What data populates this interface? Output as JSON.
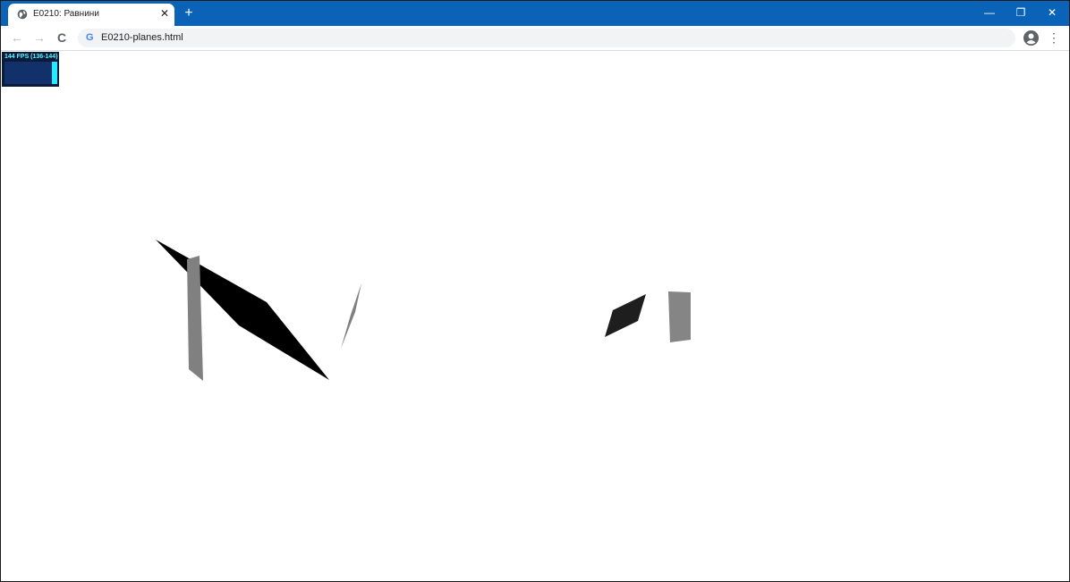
{
  "browser": {
    "tab_title": "E0210: Равнини",
    "tab_close": "✕",
    "new_tab": "+",
    "url": "E0210-planes.html",
    "back": "←",
    "forward": "→",
    "reload": "C",
    "menu": "⋮",
    "minimize": "—",
    "restore": "❐",
    "close": "✕",
    "omnibox_icon": "G",
    "accent_color": "#0b63b7"
  },
  "stats": {
    "label": "144 FPS (136-144)",
    "fps_fraction": 1.0
  },
  "scene": {
    "planes": [
      {
        "name": "plane-black-large",
        "color": "#000000"
      },
      {
        "name": "plane-gray-tall",
        "color": "#808080"
      },
      {
        "name": "plane-gray-sliver",
        "color": "#808080"
      },
      {
        "name": "plane-dark-small",
        "color": "#1e1e1e"
      },
      {
        "name": "plane-gray-rect",
        "color": "#858585"
      }
    ]
  }
}
